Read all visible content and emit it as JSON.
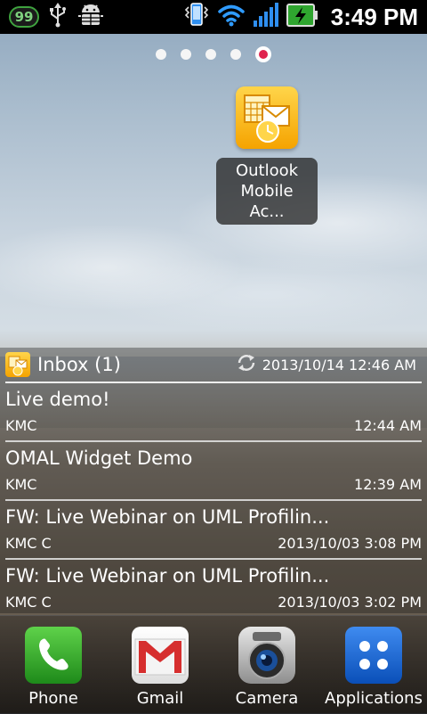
{
  "status_bar": {
    "notification_count": "99",
    "time": "3:49 PM",
    "icons": [
      "usb-icon",
      "android-debug-icon",
      "vibrate-icon",
      "wifi-icon",
      "signal-icon",
      "battery-charging-icon"
    ]
  },
  "home": {
    "pages": 5,
    "active_page": 5,
    "shortcut": {
      "label_line1": "Outlook",
      "label_line2": "Mobile Ac..."
    }
  },
  "widget": {
    "folder": "Inbox (1)",
    "last_sync": "2013/10/14 12:46 AM",
    "messages": [
      {
        "subject": "Live demo!",
        "from": "KMC",
        "time": "12:44 AM"
      },
      {
        "subject": "OMAL Widget Demo",
        "from": "KMC",
        "time": "12:39 AM"
      },
      {
        "subject": "FW: Live Webinar on UML Profilin...",
        "from": "KMC C",
        "time": "2013/10/03 3:08 PM"
      },
      {
        "subject": "FW: Live Webinar on UML Profilin...",
        "from": "KMC C",
        "time": "2013/10/03 3:02 PM"
      }
    ]
  },
  "dock": {
    "items": [
      {
        "label": "Phone",
        "icon": "phone-icon"
      },
      {
        "label": "Gmail",
        "icon": "gmail-icon"
      },
      {
        "label": "Camera",
        "icon": "camera-icon"
      },
      {
        "label": "Applications",
        "icon": "apps-grid-icon"
      }
    ]
  },
  "colors": {
    "accent_pink": "#e0234e",
    "outlook_yellow": "#f5a300",
    "battery_green": "#2fa52f",
    "signal_blue": "#2f8ff0"
  }
}
